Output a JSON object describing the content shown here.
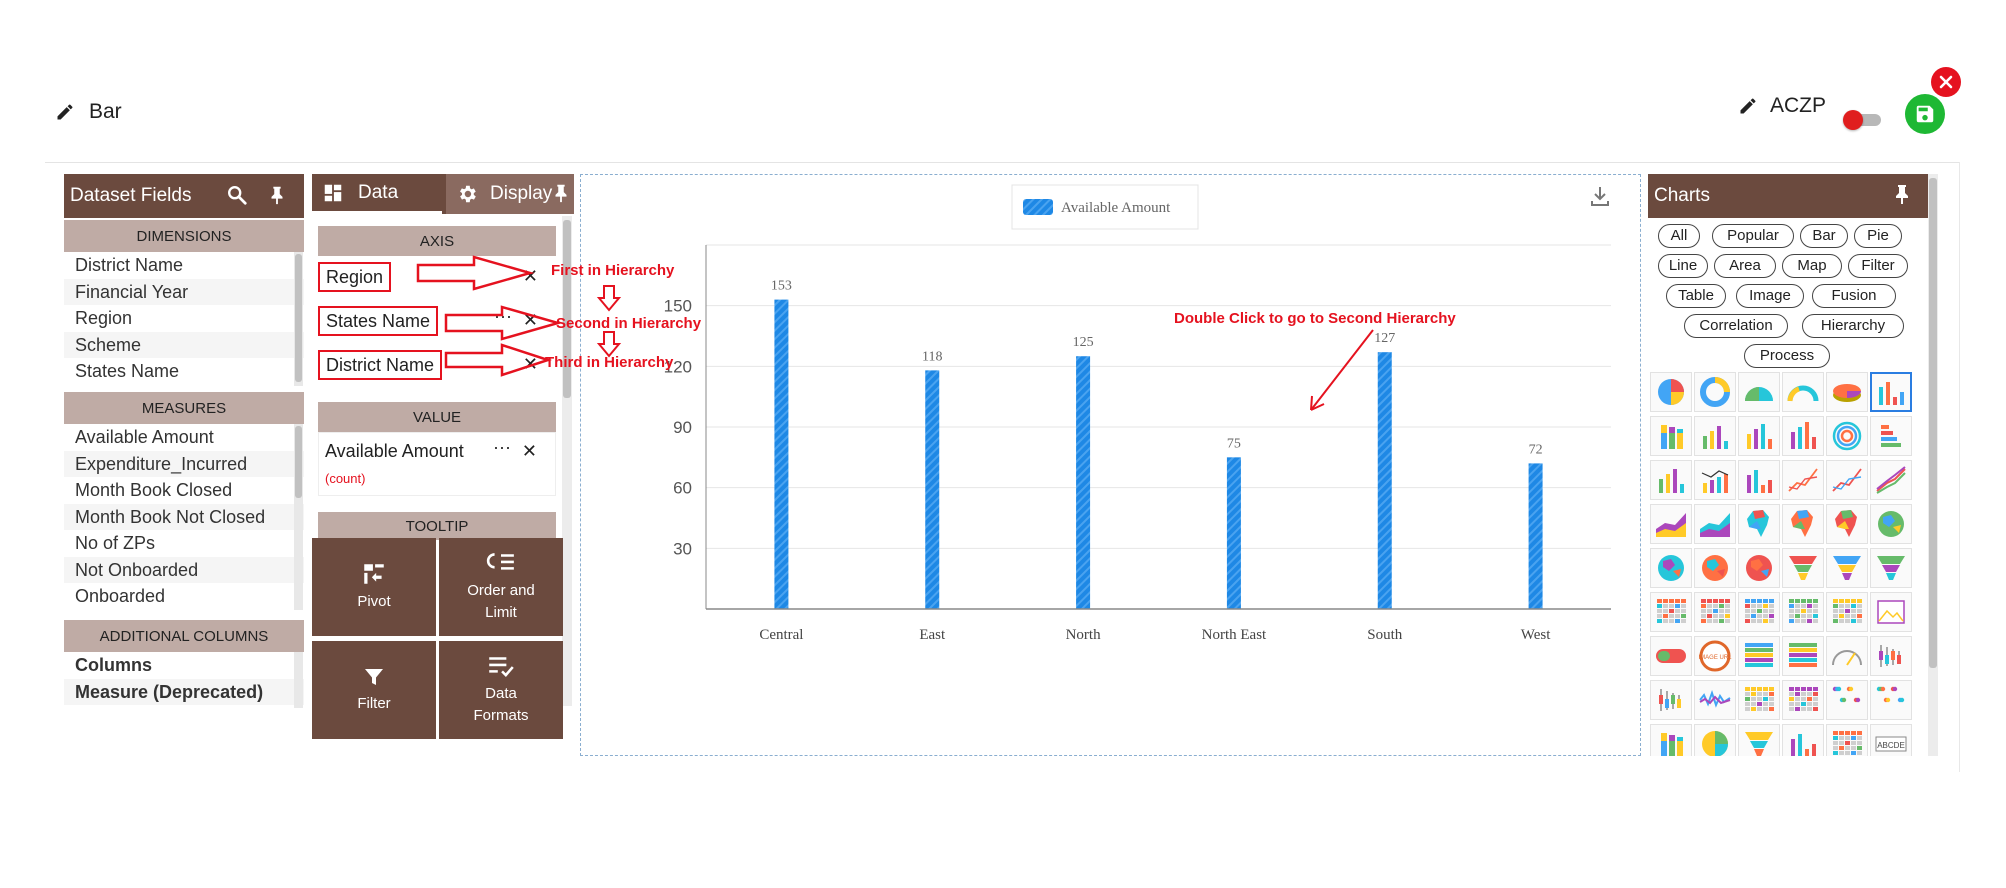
{
  "header": {
    "chart_title": "Bar",
    "dataset_name": "ACZP"
  },
  "colors": {
    "brown": "#6b4a3e",
    "tan": "#bfaba5",
    "bar_blue": "#1e88e5",
    "annotation_red": "#e5121f",
    "save_green": "#1eb834"
  },
  "dataset_panel": {
    "title": "Dataset Fields",
    "dimensions_label": "DIMENSIONS",
    "dimensions": [
      "District Name",
      "Financial Year",
      "Region",
      "Scheme",
      "States Name"
    ],
    "measures_label": "MEASURES",
    "measures": [
      "Available Amount",
      "Expenditure_Incurred",
      "Month Book Closed",
      "Month Book Not Closed",
      "No of ZPs",
      "Not Onboarded",
      "Onboarded"
    ],
    "additional_label": "ADDITIONAL COLUMNS",
    "additional": [
      "Columns",
      "Measure (Deprecated)"
    ]
  },
  "data_panel": {
    "tab_data": "Data",
    "tab_display": "Display",
    "axis_label": "AXIS",
    "axis_items": [
      "Region",
      "States Name",
      "District Name"
    ],
    "value_label": "VALUE",
    "value_item": "Available Amount",
    "value_aggregation": "(count)",
    "tooltip_label": "TOOLTIP",
    "tools": {
      "pivot": "Pivot",
      "order_line1": "Order and",
      "order_line2": "Limit",
      "filter": "Filter",
      "formats_line1": "Data",
      "formats_line2": "Formats"
    }
  },
  "annotations": {
    "first": "First in Hierarchy",
    "second": "Second in Hierarchy",
    "third": "Third in Hierarchy",
    "double_click": "Double Click to go to Second Hierarchy"
  },
  "chart_data": {
    "type": "bar",
    "categories": [
      "Central",
      "East",
      "North",
      "North East",
      "South",
      "West"
    ],
    "series": [
      {
        "name": "Available Amount",
        "values": [
          153,
          118,
          125,
          75,
          127,
          72
        ]
      }
    ],
    "yticks": [
      30,
      60,
      90,
      120,
      150
    ],
    "ylim": [
      0,
      180
    ],
    "grid": true,
    "legend": "top-center"
  },
  "charts_panel": {
    "title": "Charts",
    "filters": [
      "All",
      "Popular",
      "Bar",
      "Pie",
      "Line",
      "Area",
      "Map",
      "Filter",
      "Table",
      "Image",
      "Fusion",
      "Correlation",
      "Hierarchy",
      "Process"
    ],
    "image_badge": "IMAGE URL",
    "table_badge": "ABCDE"
  }
}
